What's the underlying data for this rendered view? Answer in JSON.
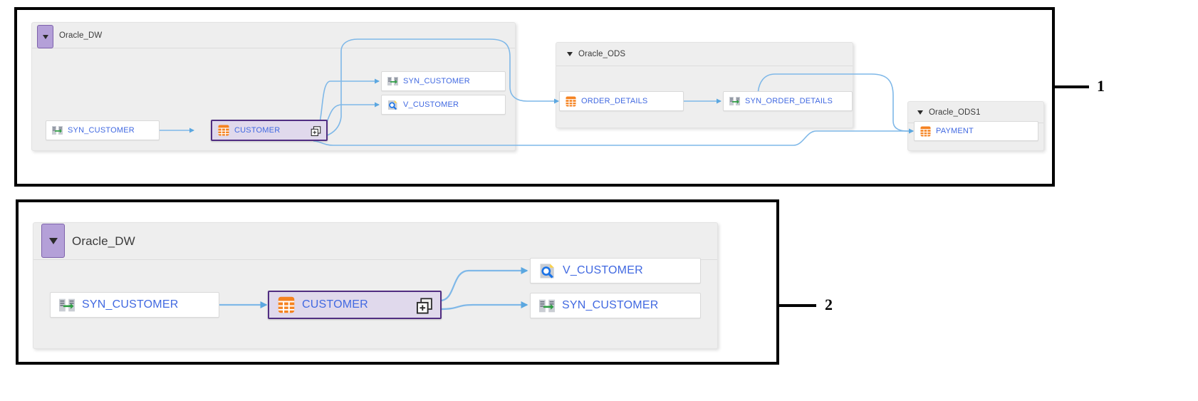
{
  "diagram": {
    "kind": "data-lineage",
    "colors": {
      "node_label": "#4169e1",
      "group_fill": "#eeeeee",
      "edge": "#7fb8e8",
      "selected_border": "#512e82",
      "selected_fill": "#e0d9ec",
      "chip_fill": "#b4a0d8",
      "table_icon": "#f58220",
      "synonym_arrow": "#2f9e44",
      "view_corner": "#ffd23f",
      "frame": "#000000"
    }
  },
  "callouts": [
    {
      "number": "1"
    },
    {
      "number": "2"
    }
  ],
  "panels": [
    {
      "id": "panel-1",
      "callout": "1",
      "groups": [
        {
          "id": "oracle-dw",
          "title": "Oracle_DW",
          "collapse_icon": "triangle-down-icon",
          "chip": true
        },
        {
          "id": "oracle-ods",
          "title": "Oracle_ODS",
          "collapse_icon": "triangle-down-icon",
          "chip": false
        },
        {
          "id": "oracle-ods1",
          "title": "Oracle_ODS1",
          "collapse_icon": "triangle-down-icon",
          "chip": false
        }
      ],
      "nodes": [
        {
          "id": "n1-syn-customer-src",
          "label": "SYN_CUSTOMER",
          "icon": "synonym-icon",
          "group": "oracle-dw",
          "selected": false,
          "expandable": false
        },
        {
          "id": "n1-customer",
          "label": "CUSTOMER",
          "icon": "table-icon",
          "group": "oracle-dw",
          "selected": true,
          "expandable": true
        },
        {
          "id": "n1-syn-customer-tgt",
          "label": "SYN_CUSTOMER",
          "icon": "synonym-icon",
          "group": "oracle-dw",
          "selected": false,
          "expandable": false
        },
        {
          "id": "n1-v-customer",
          "label": "V_CUSTOMER",
          "icon": "view-icon",
          "group": "oracle-dw",
          "selected": false,
          "expandable": false
        },
        {
          "id": "n1-order-details",
          "label": "ORDER_DETAILS",
          "icon": "table-icon",
          "group": "oracle-ods",
          "selected": false,
          "expandable": false
        },
        {
          "id": "n1-syn-order",
          "label": "SYN_ORDER_DETAILS",
          "icon": "synonym-icon",
          "group": "oracle-ods",
          "selected": false,
          "expandable": false
        },
        {
          "id": "n1-payment",
          "label": "PAYMENT",
          "icon": "table-icon",
          "group": "oracle-ods1",
          "selected": false,
          "expandable": false
        }
      ],
      "edges": [
        {
          "from": "n1-syn-customer-src",
          "to": "n1-customer"
        },
        {
          "from": "n1-customer",
          "to": "n1-syn-customer-tgt"
        },
        {
          "from": "n1-customer",
          "to": "n1-v-customer"
        },
        {
          "from": "n1-customer",
          "to": "n1-order-details"
        },
        {
          "from": "n1-customer",
          "to": "n1-payment"
        },
        {
          "from": "n1-order-details",
          "to": "n1-syn-order"
        },
        {
          "from": "n1-syn-order",
          "to": "n1-payment"
        }
      ]
    },
    {
      "id": "panel-2",
      "callout": "2",
      "groups": [
        {
          "id": "oracle-dw-2",
          "title": "Oracle_DW",
          "collapse_icon": "triangle-down-icon",
          "chip": true
        }
      ],
      "nodes": [
        {
          "id": "n2-syn-customer-src",
          "label": "SYN_CUSTOMER",
          "icon": "synonym-icon",
          "group": "oracle-dw-2",
          "selected": false,
          "expandable": false
        },
        {
          "id": "n2-customer",
          "label": "CUSTOMER",
          "icon": "table-icon",
          "group": "oracle-dw-2",
          "selected": true,
          "expandable": true
        },
        {
          "id": "n2-v-customer",
          "label": "V_CUSTOMER",
          "icon": "view-icon",
          "group": "oracle-dw-2",
          "selected": false,
          "expandable": false
        },
        {
          "id": "n2-syn-customer-tgt",
          "label": "SYN_CUSTOMER",
          "icon": "synonym-icon",
          "group": "oracle-dw-2",
          "selected": false,
          "expandable": false
        }
      ],
      "edges": [
        {
          "from": "n2-syn-customer-src",
          "to": "n2-customer"
        },
        {
          "from": "n2-customer",
          "to": "n2-v-customer"
        },
        {
          "from": "n2-customer",
          "to": "n2-syn-customer-tgt"
        }
      ]
    }
  ],
  "icon_names": {
    "table": "table-icon",
    "synonym": "synonym-icon",
    "view": "view-icon",
    "expand": "expand-plus-icon",
    "collapse": "triangle-down-icon"
  }
}
